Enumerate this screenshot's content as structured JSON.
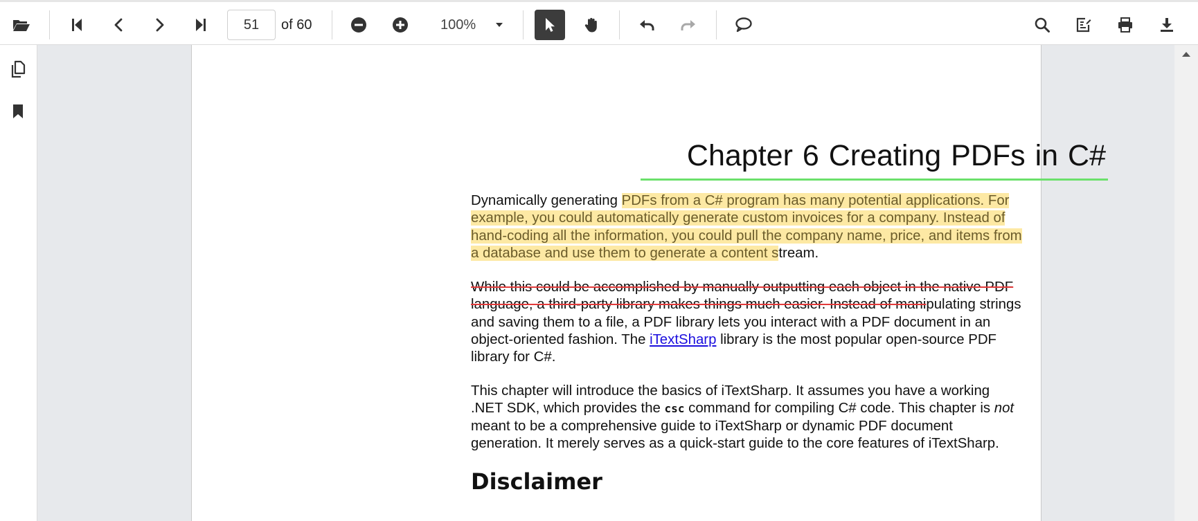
{
  "toolbar": {
    "page_current": "51",
    "page_total_label": "of 60",
    "zoom_value": "100%"
  },
  "document": {
    "chapter_title": "Chapter 6  Creating PDFs in C#",
    "p1": {
      "pre": "Dynamically generating ",
      "highlight_1": "PDFs from a C# program has many potential applications. For",
      "highlight_2": "example, you could automatically generate custom invoices for a company. Instead of",
      "highlight_3": "hand-coding all the information, you could pull the company name, price, and items from",
      "highlight_4": "a database and use them to generate a content s",
      "post": "tream."
    },
    "p2": {
      "strike_1": "While this could be accomplished by manually outputting each object in the native PDF",
      "strike_2": "language, a third-party library makes things much easier. Instead of mani",
      "rest_2": "pulating strings",
      "line_3": "and saving them to a file, a PDF library lets you interact with a PDF document in an",
      "line_4_pre": "object-oriented fashion. The ",
      "link_text": "iTextSharp",
      "line_4_post": " library is the most popular open-source PDF",
      "line_5": "library for C#."
    },
    "p3": {
      "line_1": "This chapter will introduce the basics of iTextSharp. It assumes you have a working",
      "line_2_pre": ".NET SDK, which provides the ",
      "code": "csc",
      "line_2_mid": " command for compiling C# code. This chapter is ",
      "em": "not",
      "line_3": "meant to be a comprehensive guide to iTextSharp or dynamic PDF document",
      "line_4": "generation. It merely serves as a quick-start guide to the core features of iTextSharp."
    },
    "section_heading": "Disclaimer"
  },
  "colors": {
    "highlight": "#fde9a4",
    "strikethrough": "#e23a3a",
    "underline_annotation": "#6be06b",
    "link": "#1a0dde",
    "active_tool": "#3c3c3c",
    "viewer_background": "#e7e9ec"
  },
  "icons": {
    "open": "folder-open-icon",
    "first": "first-page-icon",
    "previous": "chevron-left-icon",
    "next": "chevron-right-icon",
    "last": "last-page-icon",
    "zoom_out": "zoom-out-icon",
    "zoom_in": "zoom-in-icon",
    "zoom_dropdown": "caret-down-icon",
    "select_tool": "cursor-arrow-icon",
    "pan_tool": "hand-icon",
    "undo": "undo-icon",
    "redo": "redo-icon",
    "comment": "comment-icon",
    "search": "search-icon",
    "annotate": "edit-annotation-icon",
    "print": "printer-icon",
    "download": "download-icon",
    "page_thumbnails": "copy-pages-icon",
    "bookmarks": "bookmark-icon",
    "scroll_up": "triangle-up-icon"
  }
}
